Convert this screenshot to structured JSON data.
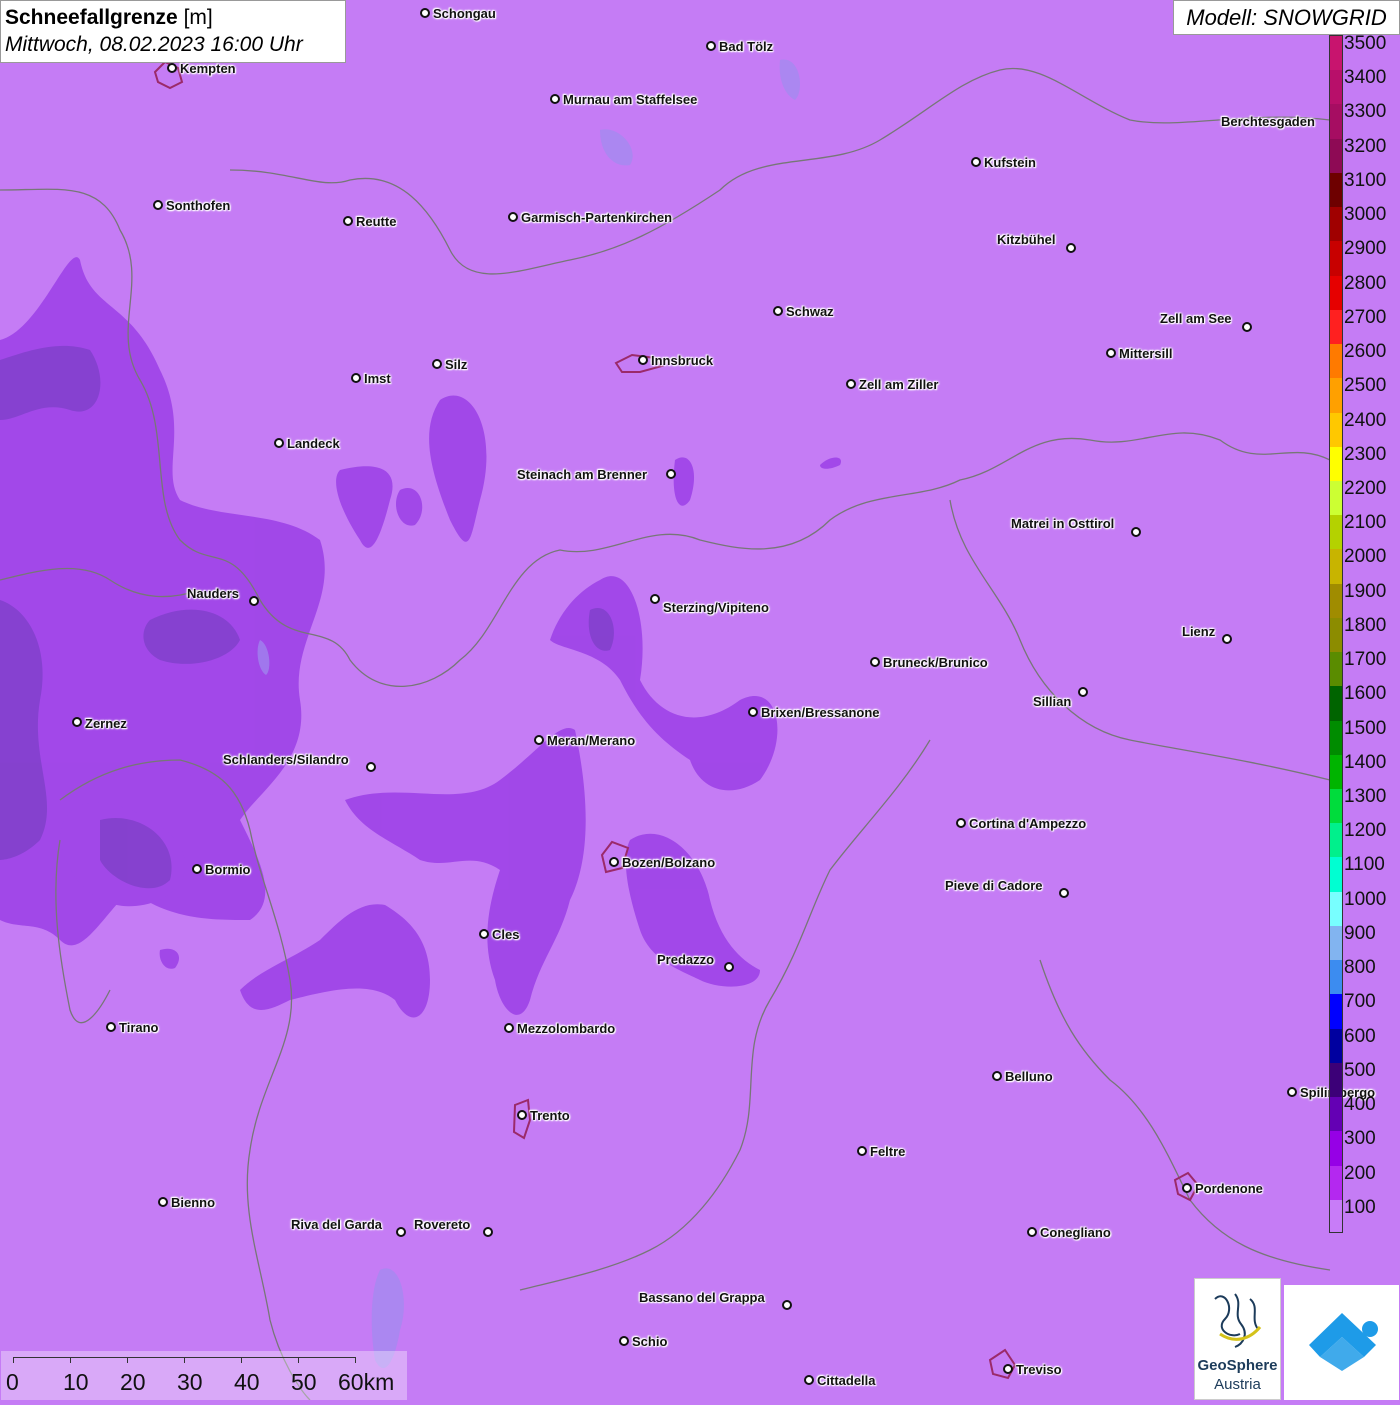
{
  "title": {
    "bold": "Schneefallgrenze",
    "unit": "[m]",
    "date": "Mittwoch, 08.02.2023 16:00 Uhr"
  },
  "model": "Modell: SNOWGRID",
  "colors": {
    "background": "#c57cf5",
    "darker_zone": "#9b40e6",
    "darkest_zone": "#7a3fc4",
    "border_lines": "#777777"
  },
  "cities": [
    {
      "id": "schongau",
      "label": "Schongau",
      "dot": [
        425,
        13
      ],
      "text": [
        433,
        6
      ]
    },
    {
      "id": "bad-toelz",
      "label": "Bad Tölz",
      "dot": [
        711,
        46
      ],
      "text": [
        719,
        39
      ]
    },
    {
      "id": "kempten",
      "label": "Kempten",
      "dot": [
        172,
        68
      ],
      "text": [
        180,
        61
      ]
    },
    {
      "id": "murnau",
      "label": "Murnau am Staffelsee",
      "dot": [
        555,
        99
      ],
      "text": [
        563,
        92
      ]
    },
    {
      "id": "berchtesgaden",
      "label": "Berchtesgaden",
      "dot": null,
      "text": [
        1221,
        114
      ]
    },
    {
      "id": "kufstein",
      "label": "Kufstein",
      "dot": [
        976,
        162
      ],
      "text": [
        984,
        155
      ]
    },
    {
      "id": "sonthofen",
      "label": "Sonthofen",
      "dot": [
        158,
        205
      ],
      "text": [
        166,
        198
      ]
    },
    {
      "id": "reutte",
      "label": "Reutte",
      "dot": [
        348,
        221
      ],
      "text": [
        356,
        214
      ]
    },
    {
      "id": "garmisch",
      "label": "Garmisch-Partenkirchen",
      "dot": [
        513,
        217
      ],
      "text": [
        521,
        210
      ]
    },
    {
      "id": "kitzbuehel",
      "label": "Kitzbühel",
      "dot": [
        1071,
        248
      ],
      "text": [
        997,
        232
      ]
    },
    {
      "id": "schwaz",
      "label": "Schwaz",
      "dot": [
        778,
        311
      ],
      "text": [
        786,
        304
      ]
    },
    {
      "id": "zell-am-see",
      "label": "Zell am See",
      "dot": [
        1247,
        327
      ],
      "text": [
        1160,
        311
      ]
    },
    {
      "id": "mittersill",
      "label": "Mittersill",
      "dot": [
        1111,
        353
      ],
      "text": [
        1119,
        346
      ]
    },
    {
      "id": "innsbruck",
      "label": "Innsbruck",
      "dot": [
        643,
        360
      ],
      "text": [
        651,
        353
      ]
    },
    {
      "id": "silz",
      "label": "Silz",
      "dot": [
        437,
        364
      ],
      "text": [
        445,
        357
      ]
    },
    {
      "id": "imst",
      "label": "Imst",
      "dot": [
        356,
        378
      ],
      "text": [
        364,
        371
      ]
    },
    {
      "id": "zell-am-ziller",
      "label": "Zell am Ziller",
      "dot": [
        851,
        384
      ],
      "text": [
        859,
        377
      ]
    },
    {
      "id": "landeck",
      "label": "Landeck",
      "dot": [
        279,
        443
      ],
      "text": [
        287,
        436
      ]
    },
    {
      "id": "steinach",
      "label": "Steinach am Brenner",
      "dot": [
        671,
        474
      ],
      "text": [
        517,
        467
      ]
    },
    {
      "id": "matrei",
      "label": "Matrei in Osttirol",
      "dot": [
        1136,
        532
      ],
      "text": [
        1011,
        516
      ]
    },
    {
      "id": "nauders",
      "label": "Nauders",
      "dot": [
        254,
        601
      ],
      "text": [
        187,
        586
      ]
    },
    {
      "id": "sterzing",
      "label": "Sterzing/Vipiteno",
      "dot": [
        655,
        599
      ],
      "text": [
        663,
        600
      ]
    },
    {
      "id": "lienz",
      "label": "Lienz",
      "dot": [
        1227,
        639
      ],
      "text": [
        1182,
        624
      ]
    },
    {
      "id": "bruneck",
      "label": "Bruneck/Brunico",
      "dot": [
        875,
        662
      ],
      "text": [
        883,
        655
      ]
    },
    {
      "id": "sillian",
      "label": "Sillian",
      "dot": [
        1083,
        692
      ],
      "text": [
        1033,
        694
      ]
    },
    {
      "id": "brixen",
      "label": "Brixen/Bressanone",
      "dot": [
        753,
        712
      ],
      "text": [
        761,
        705
      ]
    },
    {
      "id": "zernez",
      "label": "Zernez",
      "dot": [
        77,
        722
      ],
      "text": [
        85,
        716
      ]
    },
    {
      "id": "meran",
      "label": "Meran/Merano",
      "dot": [
        539,
        740
      ],
      "text": [
        547,
        733
      ]
    },
    {
      "id": "schlanders",
      "label": "Schlanders/Silandro",
      "dot": [
        371,
        767
      ],
      "text": [
        223,
        752
      ]
    },
    {
      "id": "cortina",
      "label": "Cortina d'Ampezzo",
      "dot": [
        961,
        823
      ],
      "text": [
        969,
        816
      ]
    },
    {
      "id": "bozen",
      "label": "Bozen/Bolzano",
      "dot": [
        614,
        862
      ],
      "text": [
        622,
        855
      ]
    },
    {
      "id": "bormio",
      "label": "Bormio",
      "dot": [
        197,
        869
      ],
      "text": [
        205,
        862
      ]
    },
    {
      "id": "pieve",
      "label": "Pieve di Cadore",
      "dot": [
        1064,
        893
      ],
      "text": [
        945,
        878
      ]
    },
    {
      "id": "cles",
      "label": "Cles",
      "dot": [
        484,
        934
      ],
      "text": [
        492,
        927
      ]
    },
    {
      "id": "predazzo",
      "label": "Predazzo",
      "dot": [
        729,
        967
      ],
      "text": [
        657,
        952
      ]
    },
    {
      "id": "tirano",
      "label": "Tirano",
      "dot": [
        111,
        1027
      ],
      "text": [
        119,
        1020
      ]
    },
    {
      "id": "mezzolombardo",
      "label": "Mezzolombardo",
      "dot": [
        509,
        1028
      ],
      "text": [
        517,
        1021
      ]
    },
    {
      "id": "belluno",
      "label": "Belluno",
      "dot": [
        997,
        1076
      ],
      "text": [
        1005,
        1069
      ]
    },
    {
      "id": "spilimbergo",
      "label": "Spilimbergo",
      "dot": [
        1292,
        1092
      ],
      "text": [
        1300,
        1085
      ]
    },
    {
      "id": "trento",
      "label": "Trento",
      "dot": [
        522,
        1115
      ],
      "text": [
        530,
        1108
      ]
    },
    {
      "id": "feltre",
      "label": "Feltre",
      "dot": [
        862,
        1151
      ],
      "text": [
        870,
        1144
      ]
    },
    {
      "id": "pordenone",
      "label": "Pordenone",
      "dot": [
        1187,
        1188
      ],
      "text": [
        1195,
        1181
      ]
    },
    {
      "id": "bienno",
      "label": "Bienno",
      "dot": [
        163,
        1202
      ],
      "text": [
        171,
        1195
      ]
    },
    {
      "id": "riva",
      "label": "Riva del Garda",
      "dot": [
        401,
        1232
      ],
      "text": [
        291,
        1217
      ]
    },
    {
      "id": "rovereto",
      "label": "Rovereto",
      "dot": [
        488,
        1232
      ],
      "text": [
        414,
        1217
      ]
    },
    {
      "id": "conegliano",
      "label": "Conegliano",
      "dot": [
        1032,
        1232
      ],
      "text": [
        1040,
        1225
      ]
    },
    {
      "id": "bassano",
      "label": "Bassano del Grappa",
      "dot": [
        787,
        1305
      ],
      "text": [
        639,
        1290
      ]
    },
    {
      "id": "schio",
      "label": "Schio",
      "dot": [
        624,
        1341
      ],
      "text": [
        632,
        1334
      ]
    },
    {
      "id": "treviso",
      "label": "Treviso",
      "dot": [
        1008,
        1369
      ],
      "text": [
        1016,
        1362
      ]
    },
    {
      "id": "cittadella",
      "label": "Cittadella",
      "dot": [
        809,
        1380
      ],
      "text": [
        817,
        1373
      ]
    }
  ],
  "legend": {
    "unit": "m",
    "entries": [
      {
        "value": "3500",
        "color": "#c8146e"
      },
      {
        "value": "3400",
        "color": "#b80f6a"
      },
      {
        "value": "3300",
        "color": "#a60d62"
      },
      {
        "value": "3200",
        "color": "#8e0a55"
      },
      {
        "value": "3100",
        "color": "#6e0000"
      },
      {
        "value": "3000",
        "color": "#a00000"
      },
      {
        "value": "2900",
        "color": "#c80000"
      },
      {
        "value": "2800",
        "color": "#e60000"
      },
      {
        "value": "2700",
        "color": "#ff2020"
      },
      {
        "value": "2600",
        "color": "#ff7a00"
      },
      {
        "value": "2500",
        "color": "#ffa000"
      },
      {
        "value": "2400",
        "color": "#ffc800"
      },
      {
        "value": "2300",
        "color": "#ffff00"
      },
      {
        "value": "2200",
        "color": "#ccff33"
      },
      {
        "value": "2100",
        "color": "#b4d200"
      },
      {
        "value": "2000",
        "color": "#c8b400"
      },
      {
        "value": "1900",
        "color": "#a08c00"
      },
      {
        "value": "1800",
        "color": "#8c8c00"
      },
      {
        "value": "1700",
        "color": "#5a8c00"
      },
      {
        "value": "1600",
        "color": "#006400"
      },
      {
        "value": "1500",
        "color": "#008c00"
      },
      {
        "value": "1400",
        "color": "#00b400"
      },
      {
        "value": "1300",
        "color": "#00dc3c"
      },
      {
        "value": "1200",
        "color": "#00f08c"
      },
      {
        "value": "1100",
        "color": "#00ffd2"
      },
      {
        "value": "1000",
        "color": "#78ffff"
      },
      {
        "value": "900",
        "color": "#82b4f0"
      },
      {
        "value": "800",
        "color": "#3c8cf0"
      },
      {
        "value": "700",
        "color": "#0000ff"
      },
      {
        "value": "600",
        "color": "#0000a0"
      },
      {
        "value": "500",
        "color": "#3c0078"
      },
      {
        "value": "400",
        "color": "#6400b4"
      },
      {
        "value": "300",
        "color": "#9600e6"
      },
      {
        "value": "200",
        "color": "#b428f0"
      },
      {
        "value": "100",
        "color": "#c87cf8"
      }
    ]
  },
  "scalebar": {
    "labels": [
      "0",
      "10",
      "20",
      "30",
      "40",
      "50",
      "60km"
    ]
  },
  "logos": {
    "geosphere_line1": "GeoSphere",
    "geosphere_line2": "Austria"
  }
}
